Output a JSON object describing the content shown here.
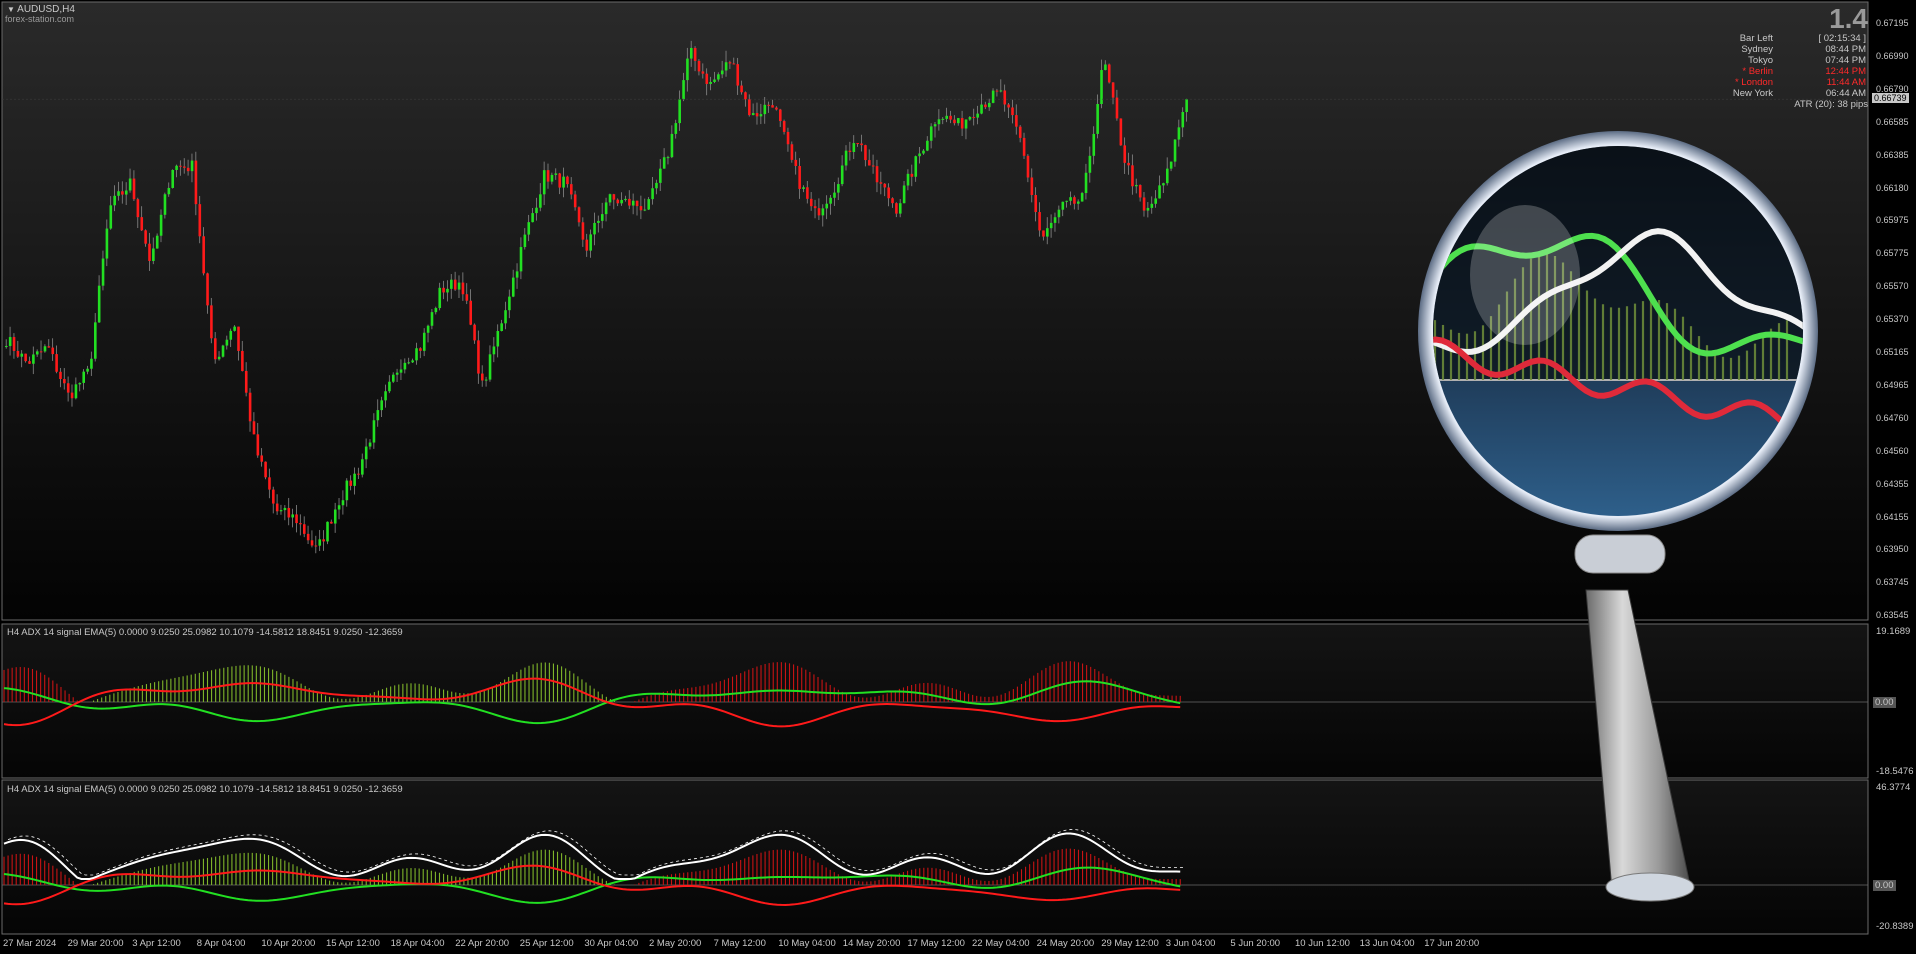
{
  "window": {
    "symbol_title": "AUDUSD,H4",
    "watermark": "forex-station.com"
  },
  "info_panel": {
    "big_value": "1.4",
    "rows": [
      {
        "label": "Bar Left",
        "value": "[ 02:15:34 ]",
        "color": "#c8c8c8"
      },
      {
        "label": "Sydney",
        "value": "08:44 PM",
        "color": "#c8c8c8"
      },
      {
        "label": "Tokyo",
        "value": "07:44 PM",
        "color": "#c8c8c8"
      },
      {
        "label": "* Berlin",
        "value": "12:44 PM",
        "color": "#ff2a2a"
      },
      {
        "label": "* London",
        "value": "11:44 AM",
        "color": "#ff2a2a"
      },
      {
        "label": "New York",
        "value": "06:44 AM",
        "color": "#c8c8c8"
      }
    ],
    "atr_text": "ATR (20): 38 pips"
  },
  "price_axis": {
    "labels": [
      "0.67195",
      "0.66990",
      "0.66790",
      "0.66585",
      "0.66385",
      "0.66180",
      "0.65975",
      "0.65775",
      "0.65570",
      "0.65370",
      "0.65165",
      "0.64965",
      "0.64760",
      "0.64560",
      "0.64355",
      "0.64155",
      "0.63950",
      "0.63745",
      "0.63545"
    ],
    "current_price": "0.66739"
  },
  "indicator1": {
    "header": "H4 ADX 14  signal EMA(5)  0.0000 9.0250 25.0982 10.1079 -14.5812 18.8451 9.0250 -12.3659",
    "scale_top": "19.1689",
    "scale_zero": "0.00",
    "scale_bottom": "-18.5476"
  },
  "indicator2": {
    "header": "H4 ADX 14  signal EMA(5)  0.0000 9.0250 25.0982 10.1079 -14.5812 18.8451 9.0250 -12.3659",
    "scale_top": "46.3774",
    "scale_zero": "0.00",
    "scale_bottom": "-20.8389"
  },
  "time_axis": {
    "labels": [
      "27 Mar 2024",
      "29 Mar 20:00",
      "3 Apr 12:00",
      "8 Apr 04:00",
      "10 Apr 20:00",
      "15 Apr 12:00",
      "18 Apr 04:00",
      "22 Apr 20:00",
      "25 Apr 12:00",
      "30 Apr 04:00",
      "2 May 20:00",
      "7 May 12:00",
      "10 May 04:00",
      "14 May 20:00",
      "17 May 12:00",
      "22 May 04:00",
      "24 May 20:00",
      "29 May 12:00",
      "3 Jun 04:00",
      "5 Jun 20:00",
      "10 Jun 12:00",
      "13 Jun 04:00",
      "17 Jun 20:00"
    ]
  },
  "colors": {
    "bull": "#22e022",
    "bear": "#ff1a1a",
    "histogram_up": "#7fb52a",
    "histogram_down": "#c81414",
    "adx_line": "#ffffff",
    "axis_text": "#c8c8c8"
  },
  "chart_data": {
    "type": "candlestick",
    "symbol": "AUDUSD",
    "timeframe": "H4",
    "y_range": [
      0.63545,
      0.67195
    ],
    "approx_close_path": [
      0.6525,
      0.651,
      0.652,
      0.649,
      0.6505,
      0.6605,
      0.662,
      0.657,
      0.663,
      0.663,
      0.651,
      0.6535,
      0.646,
      0.642,
      0.6415,
      0.6395,
      0.6425,
      0.6445,
      0.648,
      0.651,
      0.652,
      0.6555,
      0.656,
      0.6495,
      0.654,
      0.6585,
      0.6625,
      0.662,
      0.658,
      0.661,
      0.6608,
      0.6605,
      0.664,
      0.67,
      0.668,
      0.6695,
      0.666,
      0.667,
      0.663,
      0.66,
      0.6618,
      0.665,
      0.6622,
      0.6605,
      0.6635,
      0.6663,
      0.6655,
      0.6668,
      0.6675,
      0.6645,
      0.6585,
      0.6605,
      0.661,
      0.6695,
      0.6635,
      0.66,
      0.6622,
      0.6674
    ]
  }
}
